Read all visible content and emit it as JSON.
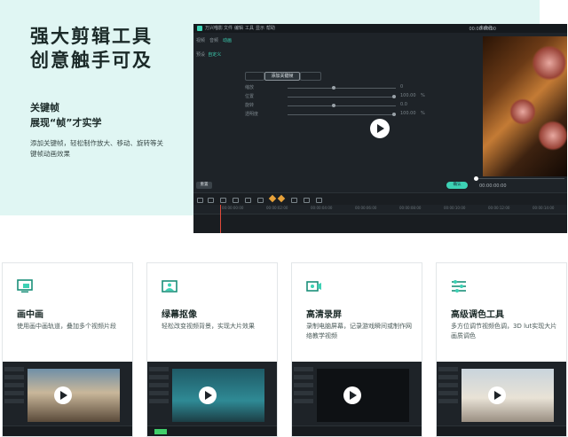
{
  "hero": {
    "title_line1": "强大剪辑工具",
    "title_line2": "创意触手可及",
    "keyframe_title": "关键帧",
    "keyframe_subtitle": "展现“帧”才实学",
    "keyframe_desc": "添加关键帧，轻松制作放大、移动、旋转等关键帧动画效果"
  },
  "editor": {
    "menu_items": [
      "万兴喵影",
      "文件",
      "编辑",
      "工具",
      "显示",
      "帮助"
    ],
    "project_label": "未命名",
    "preview_time": "00:00:00:00",
    "tabs": [
      "视频",
      "音频",
      "动画"
    ],
    "sub_tabs": [
      "预设",
      "自定义"
    ],
    "keyframe_button": "添加关键帧",
    "reset_button": "重置",
    "ok_button": "确认",
    "properties": [
      {
        "label": "缩放",
        "value": "0",
        "unit": ""
      },
      {
        "label": "位置",
        "value": "100.00",
        "unit": "%"
      },
      {
        "label": "旋转",
        "value": "0.0",
        "unit": ""
      },
      {
        "label": "透明度",
        "value": "100.00",
        "unit": "%"
      }
    ],
    "ruler_ticks": [
      "00:00:00:00",
      "00:00:02:00",
      "00:00:04:00",
      "00:00:06:00",
      "00:00:08:00",
      "00:00:10:00",
      "00:00:12:00",
      "00:00:14:00"
    ]
  },
  "features": [
    {
      "icon": "picture-in-picture-icon",
      "title": "画中画",
      "desc": "使用画中画轨道，叠加多个视频片段"
    },
    {
      "icon": "green-screen-icon",
      "title": "绿幕抠像",
      "desc": "轻松改变视频背景，实现大片效果"
    },
    {
      "icon": "screen-record-icon",
      "title": "高清录屏",
      "desc": "录制电脑屏幕，记录游戏瞬间或制作网络教学视频"
    },
    {
      "icon": "color-adjust-icon",
      "title": "高级调色工具",
      "desc": "多方位调节视频色调，3D lut实现大片画质调色"
    }
  ],
  "colors": {
    "accent": "#3dd1b4",
    "hero_bg": "#e0f6f3",
    "editor_bg": "#1e2328"
  }
}
